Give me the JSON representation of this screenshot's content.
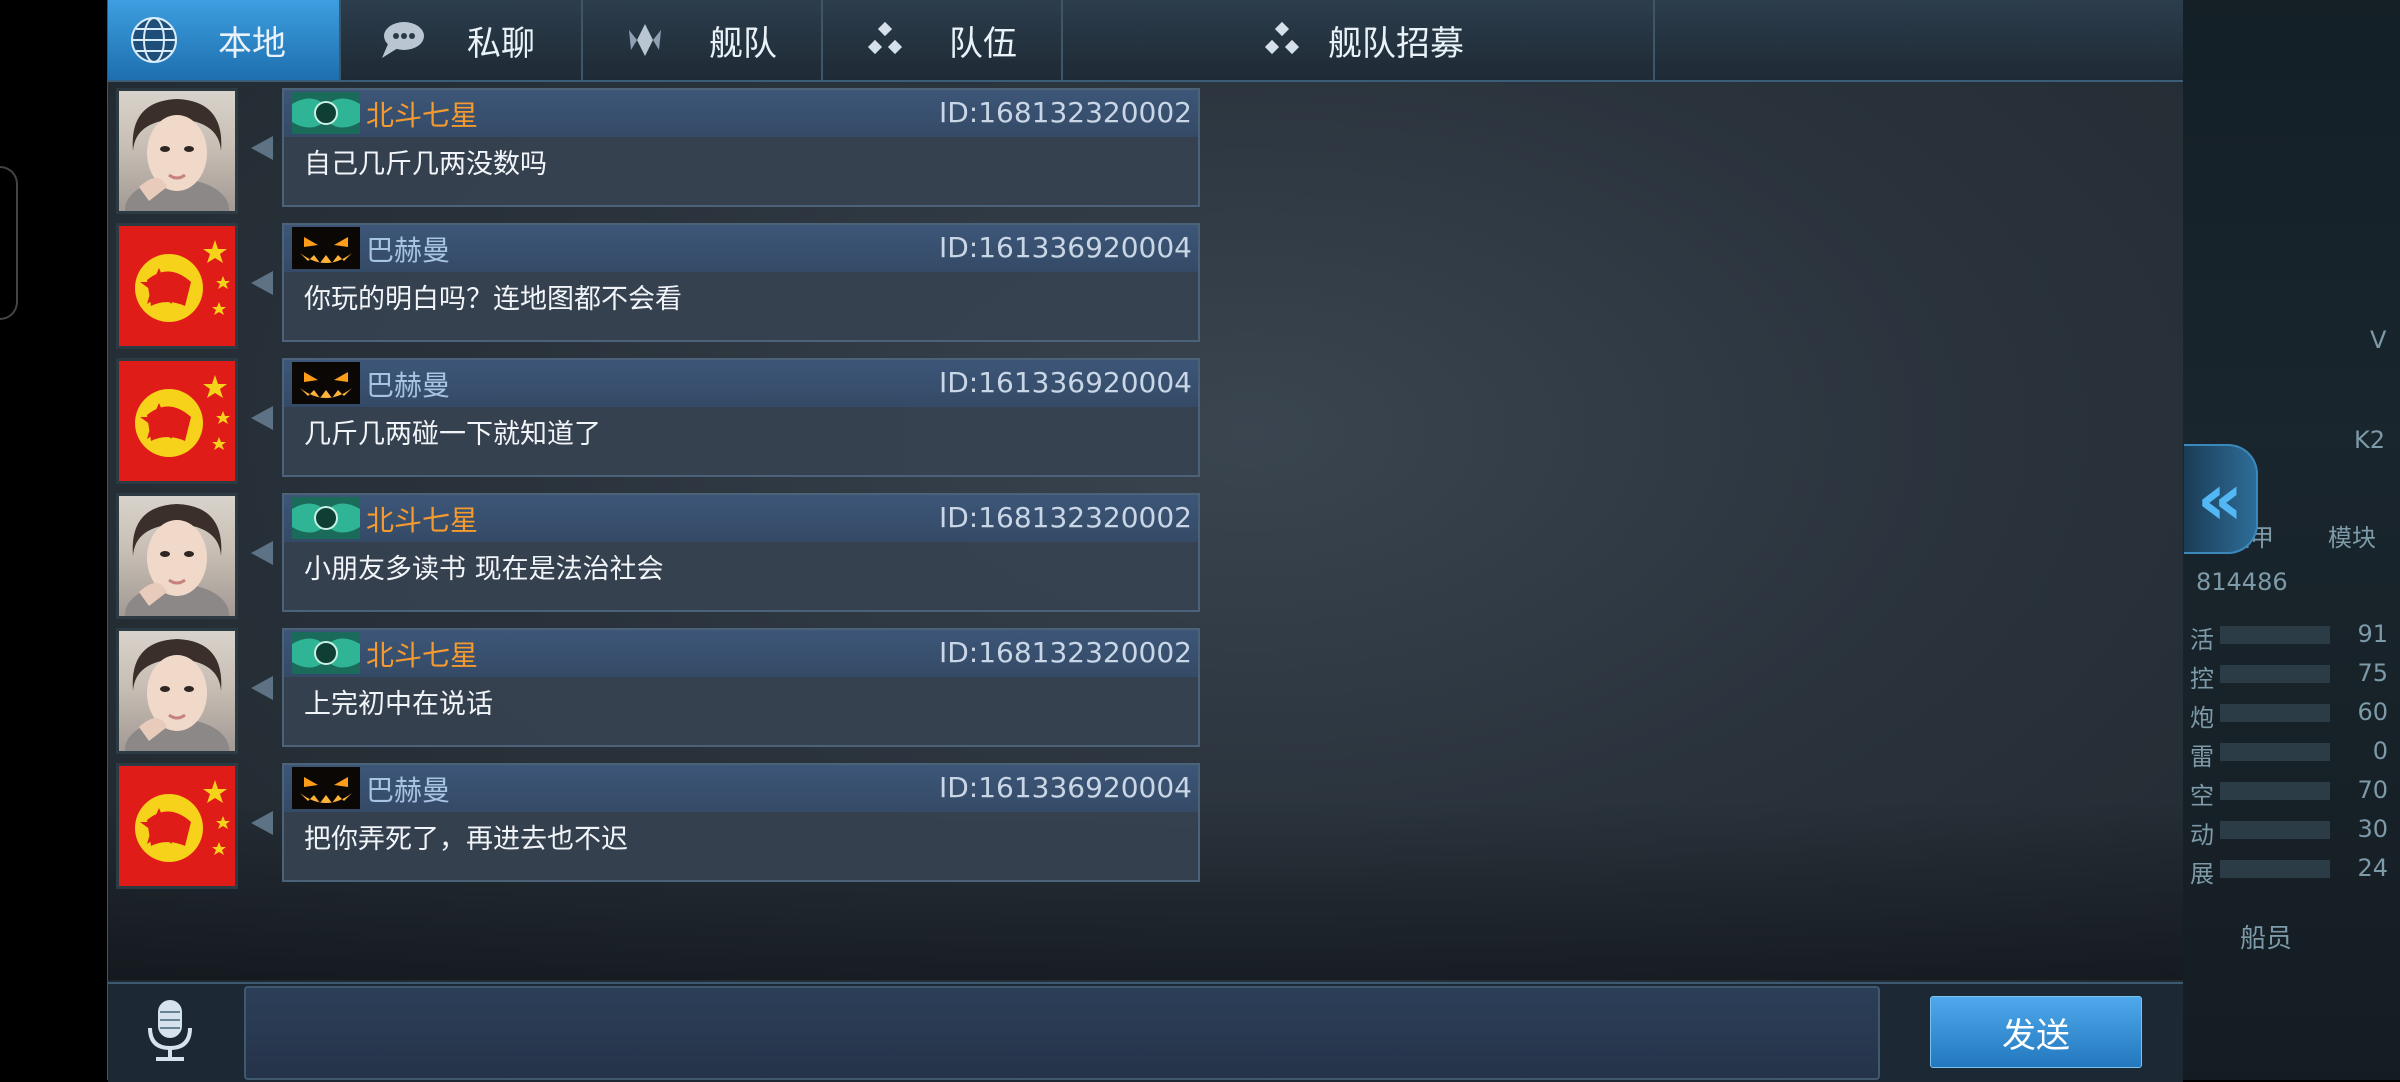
{
  "tabs": [
    {
      "label": "本地",
      "icon": "globe-icon",
      "active": true
    },
    {
      "label": "私聊",
      "icon": "chat-bubble-icon",
      "active": false
    },
    {
      "label": "舰队",
      "icon": "fleet-emblem-icon",
      "active": false
    },
    {
      "label": "队伍",
      "icon": "team-dots-icon",
      "active": false
    },
    {
      "label": "舰队招募",
      "icon": "team-dots-icon",
      "active": false
    }
  ],
  "messages": [
    {
      "sender": "北斗七星",
      "id": "ID:168132320002",
      "text": "自己几斤几两没数吗",
      "avatar": "portrait-photo",
      "badge": "green-emblem-badge",
      "name_color": "orange"
    },
    {
      "sender": "巴赫曼",
      "id": "ID:161336920004",
      "text": "你玩的明白吗？连地图都不会看",
      "avatar": "red-flag-emblem",
      "badge": "pumpkin-badge",
      "name_color": "blue"
    },
    {
      "sender": "巴赫曼",
      "id": "ID:161336920004",
      "text": "几斤几两碰一下就知道了",
      "avatar": "red-flag-emblem",
      "badge": "pumpkin-badge",
      "name_color": "blue"
    },
    {
      "sender": "北斗七星",
      "id": "ID:168132320002",
      "text": "小朋友多读书 现在是法治社会",
      "avatar": "portrait-photo",
      "badge": "green-emblem-badge",
      "name_color": "orange"
    },
    {
      "sender": "北斗七星",
      "id": "ID:168132320002",
      "text": "上完初中在说话",
      "avatar": "portrait-photo",
      "badge": "green-emblem-badge",
      "name_color": "orange"
    },
    {
      "sender": "巴赫曼",
      "id": "ID:161336920004",
      "text": "把你弄死了，再进去也不迟",
      "avatar": "red-flag-emblem",
      "badge": "pumpkin-badge",
      "name_color": "blue"
    }
  ],
  "input": {
    "placeholder": "",
    "value": ""
  },
  "send_label": "发送",
  "background_panel": {
    "id_fragment": "814486",
    "stats": [
      {
        "label": "活",
        "value": "91"
      },
      {
        "label": "控",
        "value": "75"
      },
      {
        "label": "炮",
        "value": "60"
      },
      {
        "label": "雷",
        "value": "0"
      },
      {
        "label": "空",
        "value": "70"
      },
      {
        "label": "动",
        "value": "30"
      },
      {
        "label": "展",
        "value": "24"
      }
    ],
    "crew_label": "船员",
    "side_labels": {
      "left": "装甲",
      "right": "模块",
      "v": "V",
      "k": "K2"
    }
  },
  "colors": {
    "accent": "#2f86cf",
    "orange_name": "#f59a2e",
    "blue_name": "#a8c4e4",
    "send": "#2f8bd6"
  }
}
